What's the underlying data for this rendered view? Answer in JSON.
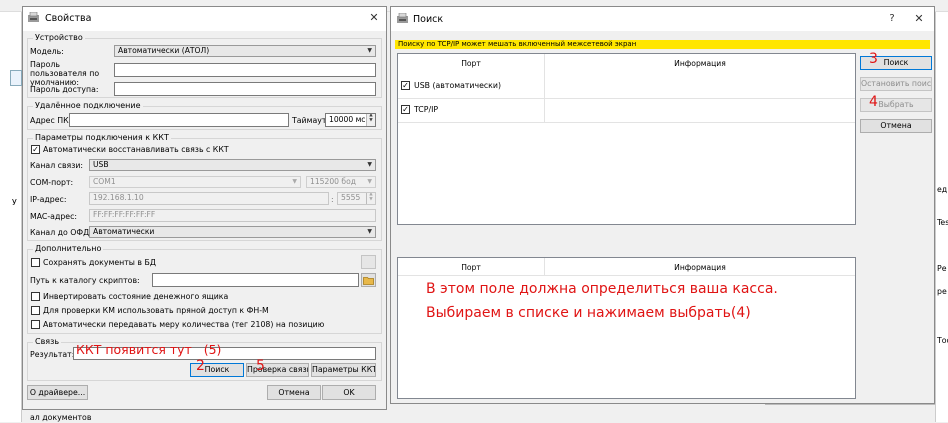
{
  "left_dialog": {
    "title": "Свойства",
    "close_glyph": "✕",
    "device_group": {
      "label": "Устройство",
      "model_label": "Модель:",
      "model_value": "Автоматически (АТОЛ)",
      "user_password_label": "Пароль пользователя по умолчанию:",
      "access_password_label": "Пароль доступа:"
    },
    "remote_group": {
      "label": "Удалённое подключение",
      "address_label": "Адрес ПК:",
      "timeout_label": "Таймаут",
      "timeout_value": "10000 мс."
    },
    "kkt_group": {
      "label": "Параметры подключения к ККТ",
      "auto_restore_label": "Автоматически восстанавливать связь с ККТ",
      "channel_label": "Канал связи:",
      "channel_value": "USB",
      "com_label": "COM-порт:",
      "com_value": "COM1",
      "baud_value": "115200 бод",
      "ip_label": "IP-адрес:",
      "ip_value": "192.168.1.10",
      "port_value": "5555",
      "mac_label": "MAC-адрес:",
      "mac_value": "FF:FF:FF:FF:FF:FF",
      "ofd_label": "Канал до ОФД:",
      "ofd_value": "Автоматически"
    },
    "extra_group": {
      "label": "Дополнительно",
      "save_docs_label": "Сохранять документы в БД",
      "scripts_label": "Путь к каталогу скриптов:",
      "invert_label": "Инвертировать состояние денежного ящика",
      "km_label": "Для проверки КМ использовать пряной доступ к ФН-М",
      "auto_tag_label": "Автоматически передавать меру количества (тег 2108) на позицию"
    },
    "link_group": {
      "label": "Связь",
      "result_label": "Результат:",
      "result_overlay": "ККТ появится тут   (5)",
      "search_button": "Поиск",
      "check_button": "Проверка связи",
      "params_button": "Параметры ККТ"
    },
    "driver_button": "О драйвере...",
    "cancel_button": "Отмена",
    "ok_button": "OK",
    "annotation_2": "2",
    "annotation_5": "5"
  },
  "right_dialog": {
    "title": "Поиск",
    "help_glyph": "?",
    "close_glyph": "✕",
    "warning": "Поиску по TCP/IP может мешать включенный межсетевой экран",
    "top_list": {
      "col_port": "Порт",
      "col_info": "Информация",
      "rows": [
        {
          "port": "USB (автоматически)",
          "checked": true
        },
        {
          "port": "TCP/IP",
          "checked": true
        }
      ]
    },
    "bottom_list": {
      "col_port": "Порт",
      "col_info": "Информация"
    },
    "instruction_line1": "В этом поле должна определиться ваша касса.",
    "instruction_line2": "Выбираем в списке и нажимаем выбрать(4)",
    "search_button": "Поиск",
    "stop_button": "Остановить поиск",
    "select_button": "Выбрать",
    "cancel_button": "Отмена",
    "annotation_3": "3",
    "annotation_4": "4"
  },
  "background": {
    "bottom_left_text": "ал документов",
    "left_edge_text": "У",
    "right_edge_texts": [
      "ед",
      "Tes",
      "Ре",
      "ре",
      "Тос"
    ]
  },
  "colors": {
    "warning_bg": "#ffe600",
    "annotation_red": "#e01414",
    "focus_blue": "#0078d7"
  }
}
